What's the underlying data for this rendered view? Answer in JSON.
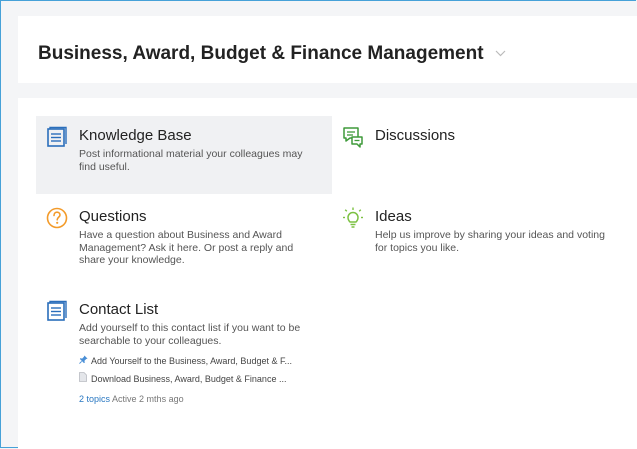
{
  "header": {
    "title": "Business, Award, Budget & Finance Management"
  },
  "tiles": [
    {
      "title": "Knowledge Base",
      "description": "Post informational material your colleagues may find useful."
    },
    {
      "title": "Discussions",
      "description": ""
    },
    {
      "title": "Questions",
      "description": "Have a question about Business and Award Management? Ask it here. Or post a reply and share your knowledge."
    },
    {
      "title": "Ideas",
      "description": "Help us improve by sharing your ideas and voting for topics you like."
    },
    {
      "title": "Contact List",
      "description": "Add yourself to this contact list if you want to be searchable to your colleagues.",
      "topics": [
        {
          "icon": "pin-icon",
          "label": "Add Yourself to the Business, Award, Budget & F..."
        },
        {
          "icon": "document-icon",
          "label": "Download Business, Award, Budget & Finance ..."
        }
      ],
      "topics_count": "2 topics",
      "activity": "Active 2 mths ago"
    }
  ],
  "colors": {
    "accent_blue": "#2a6ebb",
    "discussion_green": "#3f9a3a",
    "question_orange": "#f39b2a",
    "idea_green": "#7cc142",
    "link": "#2a78c2"
  }
}
